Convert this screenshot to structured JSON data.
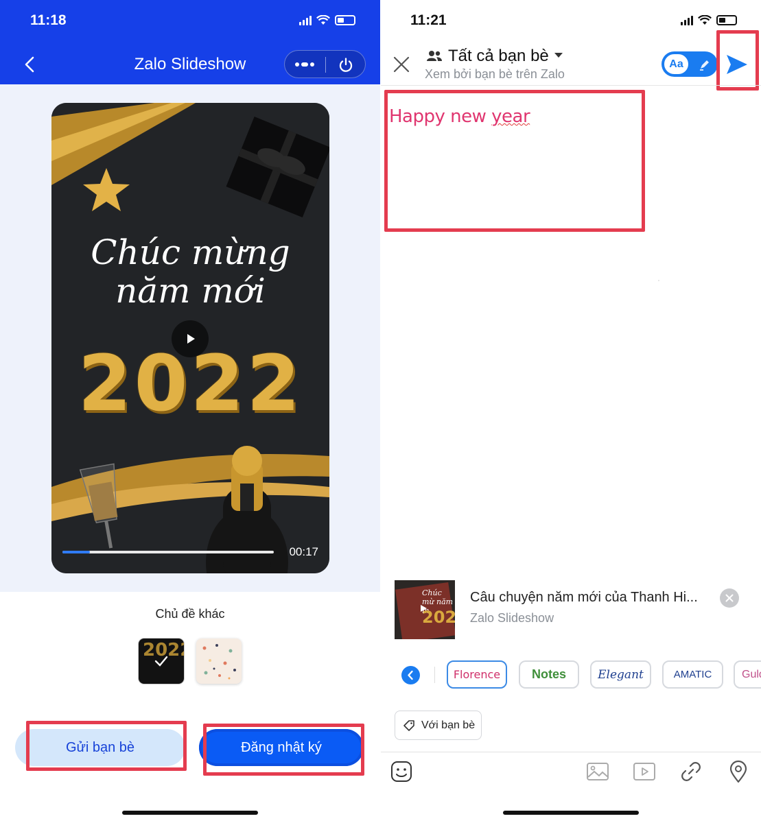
{
  "left": {
    "status_time": "11:18",
    "header_title": "Zalo Slideshow",
    "video": {
      "greeting_line1": "Chúc mừng",
      "greeting_line2": "năm mới",
      "big_year": "2022",
      "progress": 0.13,
      "time": "00:17"
    },
    "themes_label": "Chủ đề khác",
    "themes": [
      {
        "name": "2022 gold",
        "selected": true
      },
      {
        "name": "confetti",
        "selected": false
      }
    ],
    "send_friends_label": "Gửi bạn bè",
    "post_diary_label": "Đăng nhật ký",
    "colors": {
      "header": "#1640e8",
      "primary": "#0a5bf5",
      "highlight": "#e43c4f"
    }
  },
  "right": {
    "status_time": "11:21",
    "audience": "Tất cả bạn bè",
    "audience_sub": "Xem bởi bạn bè trên Zalo",
    "font_toggle_label": "Aa",
    "compose_text_a": "Happy new ",
    "compose_text_b": "year",
    "attachment": {
      "thumb_text": "Chúc mừ năm m",
      "thumb_year": "202",
      "title": "Câu chuyện năm mới của Thanh Hi...",
      "subtitle": "Zalo Slideshow"
    },
    "fonts": [
      "Florence",
      "Notes",
      "Elegant",
      "AMATIC",
      "Guld"
    ],
    "tag_label": "Với bạn bè",
    "tools": [
      "sticker-icon",
      "image-icon",
      "video-icon",
      "link-icon",
      "location-icon"
    ],
    "colors": {
      "accent": "#1a7cf0",
      "compose": "#e0356f"
    }
  }
}
